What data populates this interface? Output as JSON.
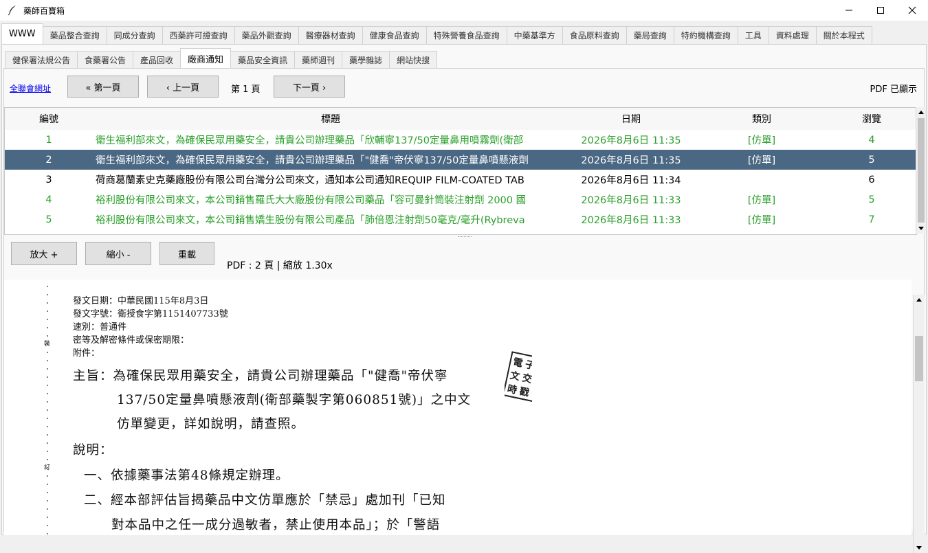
{
  "window": {
    "title": "藥師百寶箱"
  },
  "top_tabs": [
    "WWW",
    "藥品整合查詢",
    "同成分查詢",
    "西藥許可證查詢",
    "藥品外觀查詢",
    "醫療器材查詢",
    "健康食品查詢",
    "特殊營養食品查詢",
    "中藥基準方",
    "食品原料查詢",
    "藥局查詢",
    "特約機構查詢",
    "工具",
    "資料處理",
    "關於本程式"
  ],
  "sub_tabs": [
    "健保署法規公告",
    "食藥署公告",
    "產品回收",
    "廠商通知",
    "藥品安全資訊",
    "藥師週刊",
    "藥學雜誌",
    "網站快搜"
  ],
  "nav": {
    "link": "全聯會網址",
    "first": "« 第一頁",
    "prev": "‹ 上一頁",
    "page": "第 1 頁",
    "next": "下一頁 ›",
    "pdf_status": "PDF 已顯示"
  },
  "table": {
    "headers": {
      "no": "編號",
      "title": "標題",
      "date": "日期",
      "category": "類別",
      "views": "瀏覽"
    },
    "rows": [
      {
        "no": "1",
        "title": "衛生福利部來文，為確保民眾用藥安全，請貴公司辦理藥品「欣輔寧137/50定量鼻用噴霧劑(衛部",
        "date": "2026年8月6日 11:35",
        "category": "[仿單]",
        "views": "4"
      },
      {
        "no": "2",
        "title": "衛生福利部來文，為確保民眾用藥安全，請貴公司辦理藥品「\"健喬\"帝伏寧137/50定量鼻噴懸液劑",
        "date": "2026年8月6日 11:35",
        "category": "[仿單]",
        "views": "5"
      },
      {
        "no": "3",
        "title": "荷商葛蘭素史克藥廠股份有限公司台灣分公司來文，通知本公司通知REQUIP FILM-COATED TAB",
        "date": "2026年8月6日 11:34",
        "category": "",
        "views": "6"
      },
      {
        "no": "4",
        "title": "裕利股份有限公司來文，本公司銷售羅氏大大廠股份有限公司藥品「容可曼針筒裝注射劑 2000 國",
        "date": "2026年8月6日 11:33",
        "category": "[仿單]",
        "views": "5"
      },
      {
        "no": "5",
        "title": "裕利股份有限公司來文，本公司銷售嬌生股份有限公司產品「肺倍恩注射劑50毫克/毫升(Rybreva",
        "date": "2026年8月6日 11:33",
        "category": "[仿單]",
        "views": "7"
      }
    ]
  },
  "zoom": {
    "in": "放大 +",
    "out": "縮小 -",
    "reload": "重載",
    "info": "PDF : 2 頁 | 縮放 1.30x"
  },
  "pdf": {
    "header_lines": [
      "發文日期：中華民國115年8月3日",
      "發文字號：衛授食字第1151407733號",
      "速別：普通件",
      "密等及解密條件或保密期限：",
      "附件："
    ],
    "margin_marks": [
      "裝",
      "訂"
    ],
    "seal_text": "電子文件交換時戳",
    "body_lines": [
      "主旨：為確保民眾用藥安全，請貴公司辦理藥品「\"健喬\"帝伏寧",
      "137/50定量鼻噴懸液劑(衛部藥製字第060851號)」之中文",
      "仿單變更，詳如說明，請查照。",
      "說明：",
      "一、依據藥事法第48條規定辦理。",
      "二、經本部評估旨揭藥品中文仿單應於「禁忌」處加刊「已知",
      "對本品中之任一成分過敏者，禁止使用本品」；於「警語"
    ]
  }
}
